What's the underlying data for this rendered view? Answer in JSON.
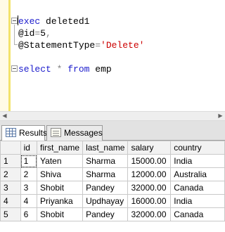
{
  "editor": {
    "lines": [
      {
        "parts": [
          {
            "t": "exec",
            "c": "kw"
          },
          {
            "t": " deleted1",
            "c": ""
          }
        ]
      },
      {
        "parts": [
          {
            "t": "@id",
            "c": ""
          },
          {
            "t": "=",
            "c": "op"
          },
          {
            "t": "5",
            "c": ""
          },
          {
            "t": ",",
            "c": "op"
          }
        ]
      },
      {
        "parts": [
          {
            "t": "@StatementType",
            "c": ""
          },
          {
            "t": "=",
            "c": "op"
          },
          {
            "t": "'Delete'",
            "c": "str"
          }
        ]
      },
      {
        "parts": []
      },
      {
        "parts": [
          {
            "t": "select",
            "c": "kw"
          },
          {
            "t": " ",
            "c": ""
          },
          {
            "t": "*",
            "c": "op"
          },
          {
            "t": " ",
            "c": ""
          },
          {
            "t": "from",
            "c": "kw"
          },
          {
            "t": " emp",
            "c": ""
          }
        ]
      }
    ]
  },
  "tabs": {
    "results_label": "Results",
    "messages_label": "Messages"
  },
  "grid": {
    "columns": [
      "id",
      "first_name",
      "last_name",
      "salary",
      "country"
    ],
    "rows": [
      {
        "num": "1",
        "cells": [
          "1",
          "Yaten",
          "Sharma",
          "15000.00",
          "India"
        ]
      },
      {
        "num": "2",
        "cells": [
          "2",
          "Shiva",
          "Sharma",
          "12000.00",
          "Australia"
        ]
      },
      {
        "num": "3",
        "cells": [
          "3",
          "Shobit",
          "Pandey",
          "32000.00",
          "Canada"
        ]
      },
      {
        "num": "4",
        "cells": [
          "4",
          "Priyanka",
          "Updhayay",
          "16000.00",
          "India"
        ]
      },
      {
        "num": "5",
        "cells": [
          "6",
          "Shobit",
          "Pandey",
          "32000.00",
          "Canada"
        ]
      }
    ]
  },
  "colors": {
    "keyword": "#1a1acc",
    "string": "#cc0000",
    "operator": "#808080",
    "margin": "#f2e36b"
  }
}
